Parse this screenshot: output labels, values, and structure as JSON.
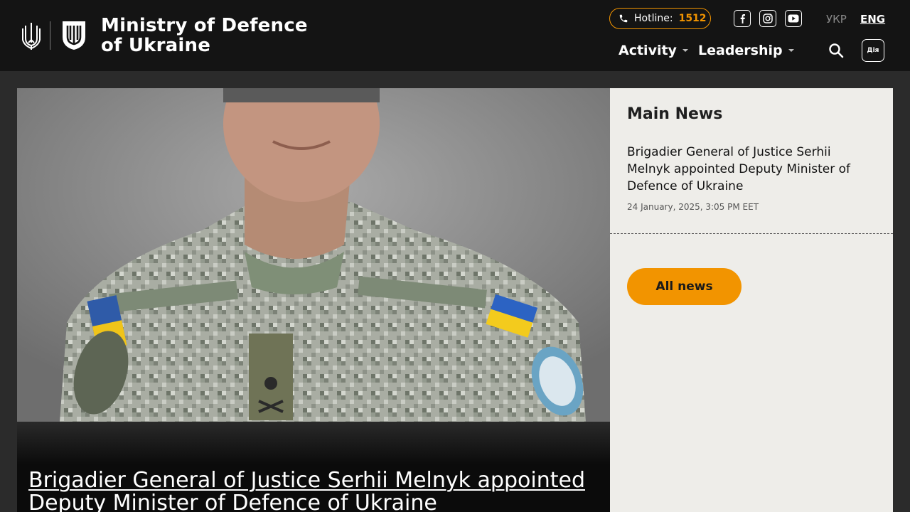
{
  "header": {
    "site_title_line1": "Ministry of Defence",
    "site_title_line2": "of Ukraine",
    "hotline_label": "Hotline:",
    "hotline_number": "1512",
    "lang_ukr": "УКР",
    "lang_eng": "ENG",
    "diia_label": "Дія",
    "social": [
      "facebook-icon",
      "instagram-icon",
      "youtube-icon"
    ],
    "nav": [
      {
        "label": "Activity"
      },
      {
        "label": "Leadership"
      }
    ]
  },
  "hero": {
    "title": "Brigadier General of Justice Serhii Melnyk appointed Deputy Minister of Defence of Ukraine"
  },
  "sidebar": {
    "heading": "Main News",
    "news": [
      {
        "title": "Brigadier General of Justice Serhii Melnyk appointed Deputy Minister of Defence of Ukraine",
        "date": "24 January, 2025, 3:05 PM EET"
      }
    ],
    "all_news_label": "All news"
  },
  "colors": {
    "accent": "#f29400",
    "header_bg": "#141414",
    "sidebar_bg": "#eeede9"
  }
}
